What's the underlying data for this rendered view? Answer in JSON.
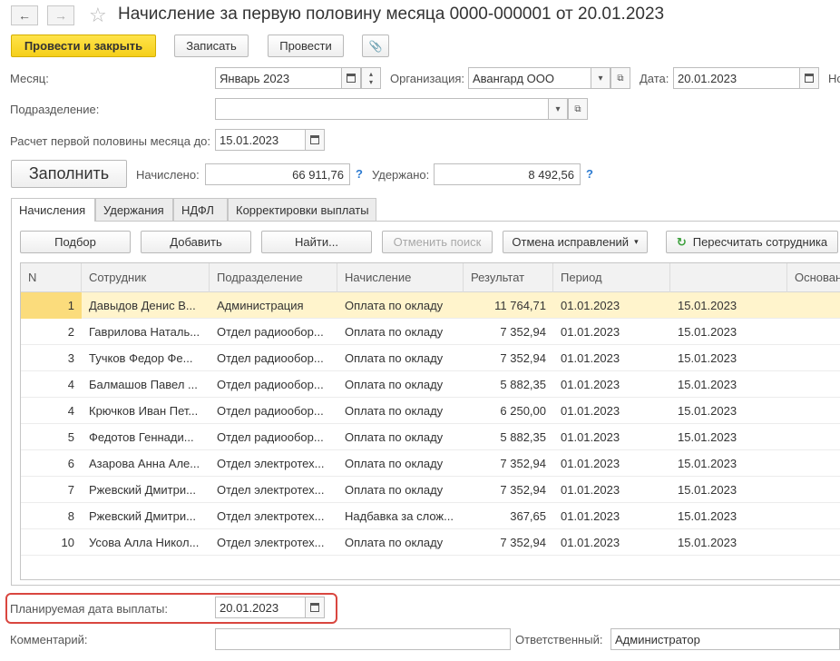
{
  "header": {
    "title": "Начисление за первую половину месяца 0000-000001 от 20.01.2023",
    "back": "←",
    "forward": "→",
    "star": "☆"
  },
  "toolbar": {
    "post_close": "Провести и закрыть",
    "save": "Записать",
    "post": "Провести",
    "attach": "📎"
  },
  "form": {
    "month_label": "Месяц:",
    "month_value": "Январь 2023",
    "org_label": "Организация:",
    "org_value": "Авангард ООО",
    "date_label": "Дата:",
    "date_value": "20.01.2023",
    "number_label_cut": "Но",
    "division_label": "Подразделение:",
    "division_value": "",
    "calc_until_label": "Расчет первой половины месяца до:",
    "calc_until_value": "15.01.2023",
    "fill_button": "Заполнить",
    "accrued_label": "Начислено:",
    "accrued_value": "66 911,76",
    "withheld_label": "Удержано:",
    "withheld_value": "8 492,56",
    "help": "?"
  },
  "tabs": [
    "Начисления",
    "Удержания",
    "НДФЛ",
    "Корректировки выплаты"
  ],
  "table_toolbar": {
    "pick": "Подбор",
    "add": "Добавить",
    "find": "Найти...",
    "cancel_search": "Отменить поиск",
    "cancel_fixes": "Отмена исправлений",
    "recalc": "Пересчитать сотрудника"
  },
  "table": {
    "columns": [
      "N",
      "Сотрудник",
      "Подразделение",
      "Начисление",
      "Результат",
      "Период",
      "",
      "Основан"
    ],
    "rows": [
      {
        "n": "1",
        "employee": "Давыдов Денис В...",
        "division": "Администрация",
        "accrual": "Оплата по окладу",
        "result": "11 764,71",
        "period_from": "01.01.2023",
        "period_to": "15.01.2023"
      },
      {
        "n": "2",
        "employee": "Гаврилова Наталь...",
        "division": "Отдел радиообор...",
        "accrual": "Оплата по окладу",
        "result": "7 352,94",
        "period_from": "01.01.2023",
        "period_to": "15.01.2023"
      },
      {
        "n": "3",
        "employee": "Тучков Федор Фе...",
        "division": "Отдел радиообор...",
        "accrual": "Оплата по окладу",
        "result": "7 352,94",
        "period_from": "01.01.2023",
        "period_to": "15.01.2023"
      },
      {
        "n": "4",
        "employee": "Балмашов Павел ...",
        "division": "Отдел радиообор...",
        "accrual": "Оплата по окладу",
        "result": "5 882,35",
        "period_from": "01.01.2023",
        "period_to": "15.01.2023"
      },
      {
        "n": "4",
        "employee": "Крючков Иван Пет...",
        "division": "Отдел радиообор...",
        "accrual": "Оплата по окладу",
        "result": "6 250,00",
        "period_from": "01.01.2023",
        "period_to": "15.01.2023"
      },
      {
        "n": "5",
        "employee": "Федотов Геннади...",
        "division": "Отдел радиообор...",
        "accrual": "Оплата по окладу",
        "result": "5 882,35",
        "period_from": "01.01.2023",
        "period_to": "15.01.2023"
      },
      {
        "n": "6",
        "employee": "Азарова Анна Але...",
        "division": "Отдел электротех...",
        "accrual": "Оплата по окладу",
        "result": "7 352,94",
        "period_from": "01.01.2023",
        "period_to": "15.01.2023"
      },
      {
        "n": "7",
        "employee": "Ржевский Дмитри...",
        "division": "Отдел электротех...",
        "accrual": "Оплата по окладу",
        "result": "7 352,94",
        "period_from": "01.01.2023",
        "period_to": "15.01.2023"
      },
      {
        "n": "8",
        "employee": "Ржевский Дмитри...",
        "division": "Отдел электротех...",
        "accrual": "Надбавка за слож...",
        "result": "367,65",
        "period_from": "01.01.2023",
        "period_to": "15.01.2023"
      },
      {
        "n": "10",
        "employee": "Усова Алла Никол...",
        "division": "Отдел электротех...",
        "accrual": "Оплата по окладу",
        "result": "7 352,94",
        "period_from": "01.01.2023",
        "period_to": "15.01.2023"
      }
    ]
  },
  "footer": {
    "planned_date_label": "Планируемая дата выплаты:",
    "planned_date_value": "20.01.2023",
    "comment_label": "Комментарий:",
    "comment_value": "",
    "responsible_label": "Ответственный:",
    "responsible_value": "Администратор"
  },
  "colors": {
    "primary_button": "#f5cf1a",
    "selected_row": "#fff4cc",
    "highlight_border": "#d9463f",
    "help_icon": "#2d7bd1"
  }
}
